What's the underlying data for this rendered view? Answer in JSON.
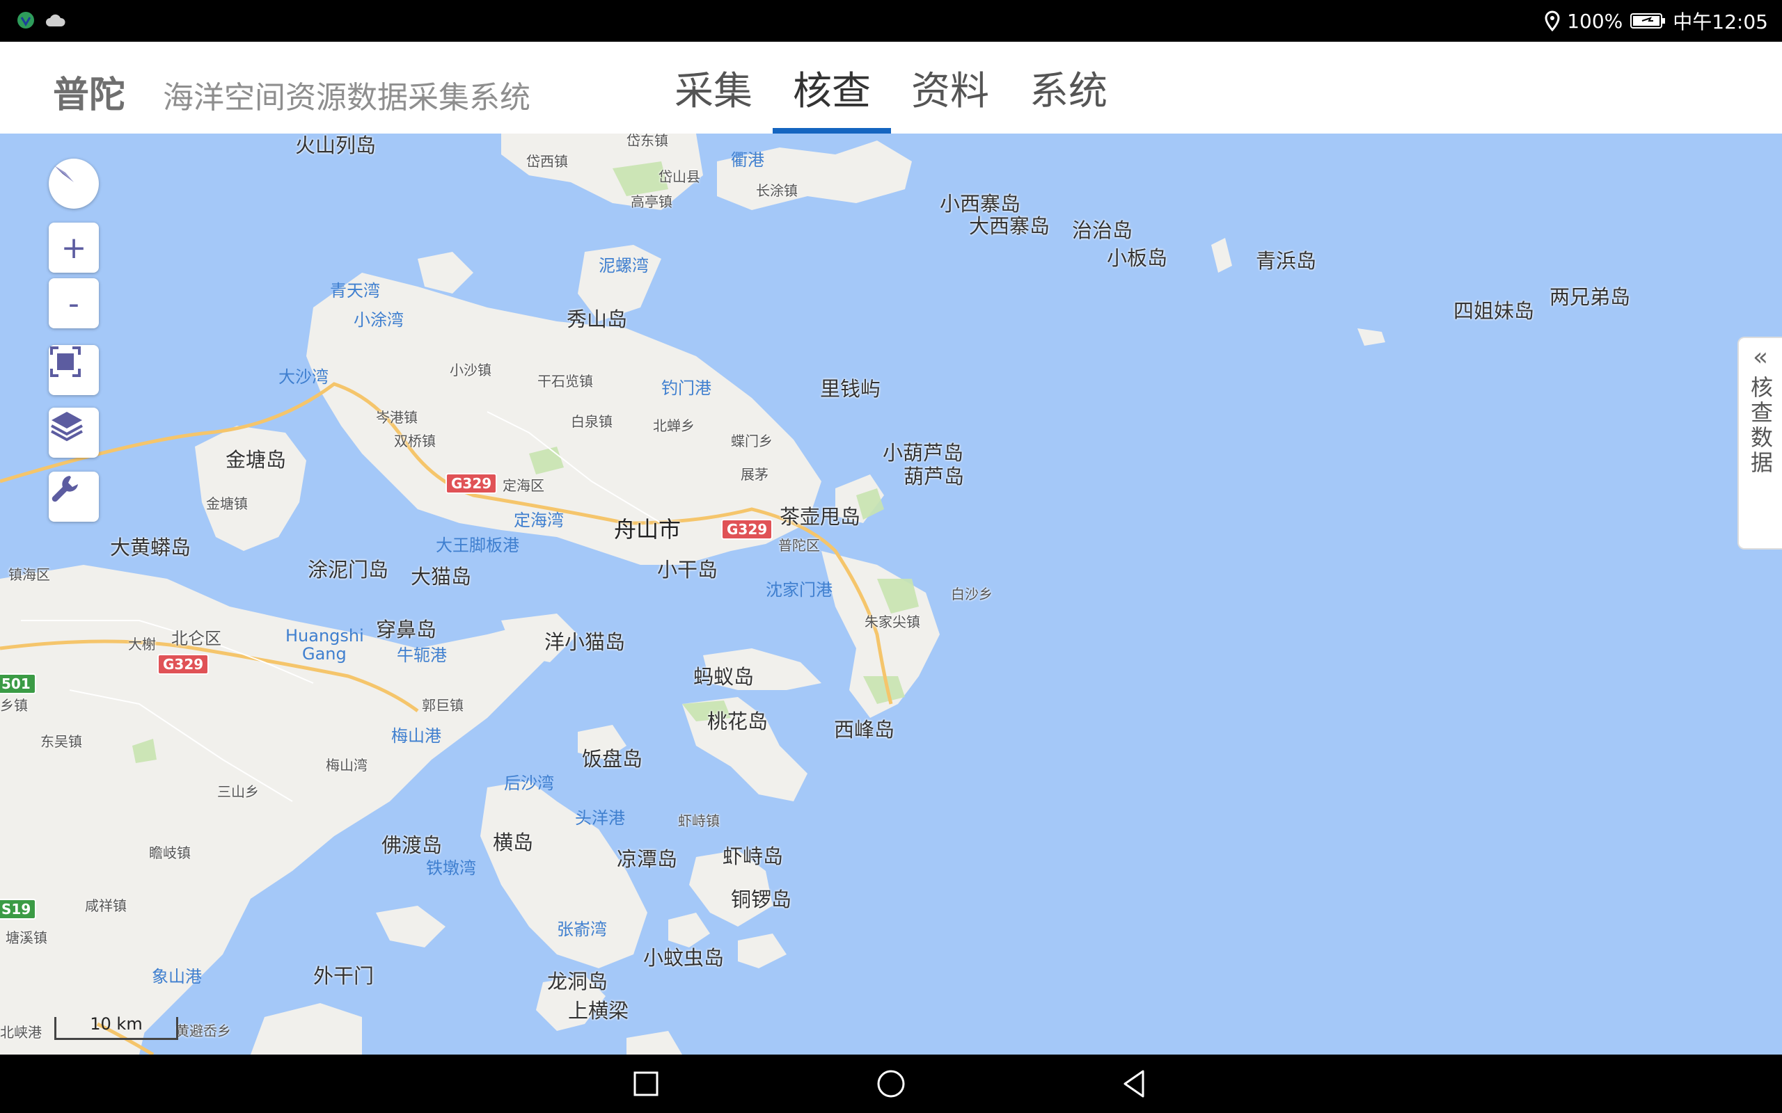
{
  "status_bar": {
    "battery": "100%",
    "time": "中午12:05"
  },
  "app": {
    "brand": "普陀",
    "subtitle": "海洋空间资源数据采集系统"
  },
  "tabs": [
    {
      "label": "采集",
      "active": false
    },
    {
      "label": "核查",
      "active": true
    },
    {
      "label": "资料",
      "active": false
    },
    {
      "label": "系统",
      "active": false
    }
  ],
  "side_panel": {
    "chevron": "«",
    "label": "核查数据"
  },
  "map_controls": [
    "compass-icon",
    "zoom-in-icon",
    "zoom-out-icon",
    "fullscreen-icon",
    "layers-icon",
    "wrench-icon"
  ],
  "zoom": {
    "plus": "+",
    "minus": "-"
  },
  "scale_bar": {
    "label": "10 km"
  },
  "roads": {
    "g329_a": "G329",
    "g329_b": "G329",
    "g329_c": "G329",
    "s501": "501",
    "s19": "S19"
  },
  "map_labels": {
    "l1": "火山列岛",
    "l2": "岱西镇",
    "l3": "岱东镇",
    "l4": "衢港",
    "l5": "岱山县",
    "l6": "长涂镇",
    "l7": "高亭镇",
    "l8": "小西寨岛",
    "l9": "大西寨岛",
    "l10": "治治岛",
    "l11": "小板岛",
    "l12": "青浜岛",
    "l13": "四姐妹岛",
    "l14": "两兄弟岛",
    "l15": "泥螺湾",
    "l16": "青天湾",
    "l17": "小涂湾",
    "l18": "秀山岛",
    "l19": "大沙湾",
    "l20": "小沙镇",
    "l21": "干石览镇",
    "l22": "钓门港",
    "l23": "里钱屿",
    "l24": "岑港镇",
    "l25": "白泉镇",
    "l26": "北蝉乡",
    "l27": "蝶门乡",
    "l28": "双桥镇",
    "l29": "金塘岛",
    "l30": "小葫芦岛",
    "l31": "葫芦岛",
    "l32": "展茅",
    "l33": "定海区",
    "l34": "金塘镇",
    "l35": "定海湾",
    "l36": "舟山市",
    "l37": "茶壶甩岛",
    "l38": "大王脚板港",
    "l39": "普陀区",
    "l40": "大黄蟒岛",
    "l41": "镇海区",
    "l42": "涂泥门岛",
    "l43": "大猫岛",
    "l44": "小干岛",
    "l45": "沈家门港",
    "l46": "白沙乡",
    "l47": "朱家尖镇",
    "l48": "穿鼻岛",
    "l49": "大榭",
    "l50": "北仑区",
    "l51": "Huangshi",
    "l52": "Gang",
    "l53": "牛轭港",
    "l54": "洋小猫岛",
    "l55": "蚂蚁岛",
    "l56": "乡镇",
    "l57": "郭巨镇",
    "l58": "桃花岛",
    "l59": "西峰岛",
    "l60": "东吴镇",
    "l61": "梅山港",
    "l62": "饭盘岛",
    "l63": "梅山湾",
    "l64": "后沙湾",
    "l65": "三山乡",
    "l66": "头洋港",
    "l67": "虾峙镇",
    "l68": "佛渡岛",
    "l69": "横岛",
    "l70": "瞻岐镇",
    "l71": "凉潭岛",
    "l72": "虾峙岛",
    "l73": "铁墩湾",
    "l74": "铜锣岛",
    "l75": "咸祥镇",
    "l76": "塘溪镇",
    "l77": "张嵛湾",
    "l78": "小蚊虫岛",
    "l79": "象山港",
    "l80": "外干门",
    "l81": "龙洞岛",
    "l82": "上横梁",
    "l83": "北峡港",
    "l84": "黄避岙乡"
  }
}
